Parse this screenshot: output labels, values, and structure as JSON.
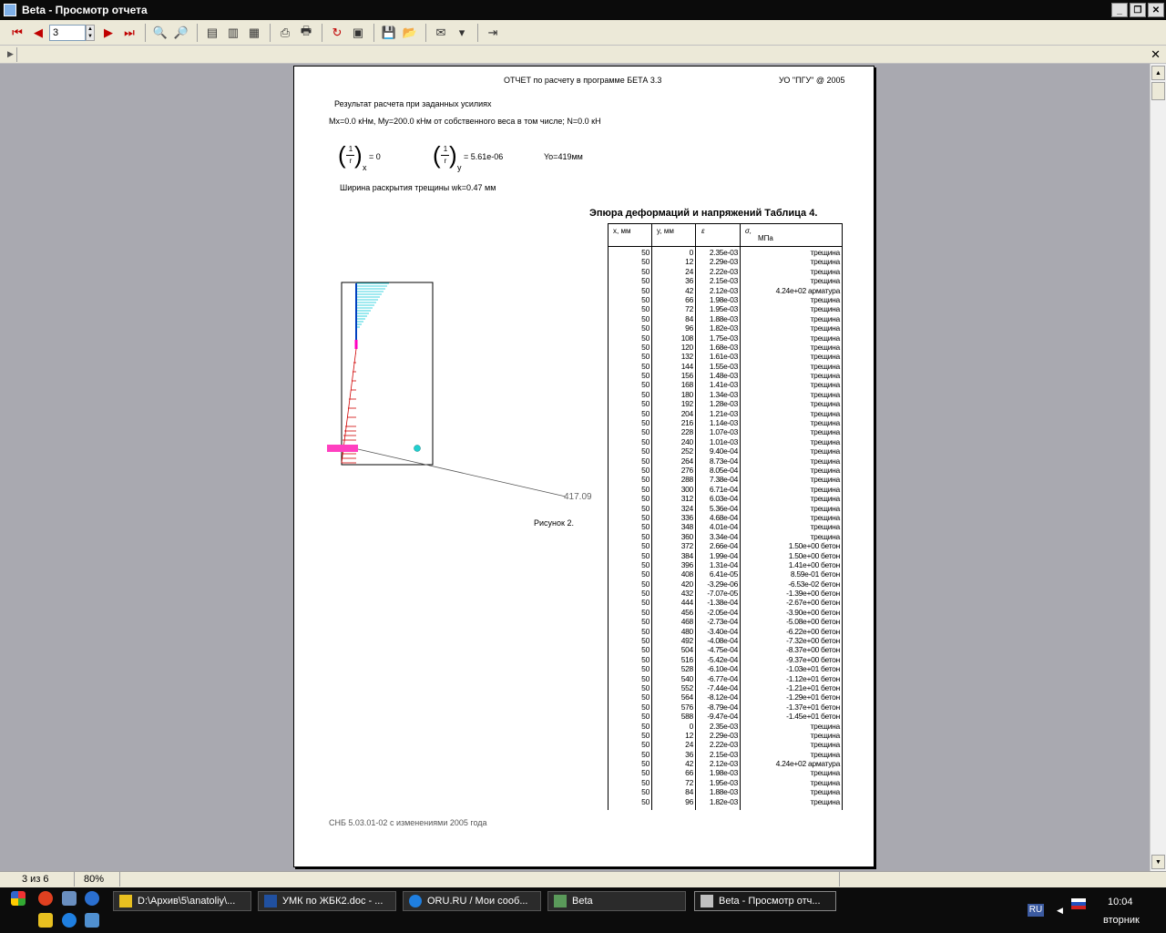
{
  "window": {
    "title": "Beta - Просмотр отчета"
  },
  "toolbar": {
    "page_value": "3"
  },
  "report": {
    "header_center": "ОТЧЕТ по расчету в программе БЕТА 3.3",
    "header_right": "УО \"ПГУ\" @ 2005",
    "result_title": "Результат расчета при заданных усилиях",
    "loads": "Mx=0.0 кНм,  My=200.0 кНм  от собственного веса в том числе;   N=0.0 кН",
    "curv_x_num": "1",
    "curv_x_den": "r",
    "curv_x_sub": "x",
    "curv_x_val": "=  0",
    "curv_y_num": "1",
    "curv_y_den": "r",
    "curv_y_sub": "y",
    "curv_y_val": "=  5.61e-06",
    "yo": "Yo=419мм",
    "crack": "Ширина раскрытия трещины wk=0.47 мм",
    "table_title": "Эпюра деформаций и напряжений    Таблица 4.",
    "figure_label": "Рисунок 2.",
    "dim_label": "417.09",
    "footer": "СНБ 5.03.01-02 с изменениями 2005 года"
  },
  "table": {
    "headers": {
      "x": "x, мм",
      "y": "y, мм",
      "eps": "ε",
      "sigma": "σ,",
      "sigma_unit": "МПа"
    },
    "rows": [
      [
        "50",
        "0",
        "2.35e-03",
        "трещина"
      ],
      [
        "50",
        "12",
        "2.29e-03",
        "трещина"
      ],
      [
        "50",
        "24",
        "2.22e-03",
        "трещина"
      ],
      [
        "50",
        "36",
        "2.15e-03",
        "трещина"
      ],
      [
        "50",
        "42",
        "2.12e-03",
        "4.24e+02 арматура"
      ],
      [
        "50",
        "66",
        "1.98e-03",
        "трещина"
      ],
      [
        "50",
        "72",
        "1.95e-03",
        "трещина"
      ],
      [
        "50",
        "84",
        "1.88e-03",
        "трещина"
      ],
      [
        "50",
        "96",
        "1.82e-03",
        "трещина"
      ],
      [
        "50",
        "108",
        "1.75e-03",
        "трещина"
      ],
      [
        "50",
        "120",
        "1.68e-03",
        "трещина"
      ],
      [
        "50",
        "132",
        "1.61e-03",
        "трещина"
      ],
      [
        "50",
        "144",
        "1.55e-03",
        "трещина"
      ],
      [
        "50",
        "156",
        "1.48e-03",
        "трещина"
      ],
      [
        "50",
        "168",
        "1.41e-03",
        "трещина"
      ],
      [
        "50",
        "180",
        "1.34e-03",
        "трещина"
      ],
      [
        "50",
        "192",
        "1.28e-03",
        "трещина"
      ],
      [
        "50",
        "204",
        "1.21e-03",
        "трещина"
      ],
      [
        "50",
        "216",
        "1.14e-03",
        "трещина"
      ],
      [
        "50",
        "228",
        "1.07e-03",
        "трещина"
      ],
      [
        "50",
        "240",
        "1.01e-03",
        "трещина"
      ],
      [
        "50",
        "252",
        "9.40e-04",
        "трещина"
      ],
      [
        "50",
        "264",
        "8.73e-04",
        "трещина"
      ],
      [
        "50",
        "276",
        "8.05e-04",
        "трещина"
      ],
      [
        "50",
        "288",
        "7.38e-04",
        "трещина"
      ],
      [
        "50",
        "300",
        "6.71e-04",
        "трещина"
      ],
      [
        "50",
        "312",
        "6.03e-04",
        "трещина"
      ],
      [
        "50",
        "324",
        "5.36e-04",
        "трещина"
      ],
      [
        "50",
        "336",
        "4.68e-04",
        "трещина"
      ],
      [
        "50",
        "348",
        "4.01e-04",
        "трещина"
      ],
      [
        "50",
        "360",
        "3.34e-04",
        "трещина"
      ],
      [
        "50",
        "372",
        "2.66e-04",
        "1.50e+00 бетон"
      ],
      [
        "50",
        "384",
        "1.99e-04",
        "1.50e+00 бетон"
      ],
      [
        "50",
        "396",
        "1.31e-04",
        "1.41e+00 бетон"
      ],
      [
        "50",
        "408",
        "6.41e-05",
        "8.59e-01 бетон"
      ],
      [
        "50",
        "420",
        "-3.29e-06",
        "-6.53e-02 бетон"
      ],
      [
        "50",
        "432",
        "-7.07e-05",
        "-1.39e+00 бетон"
      ],
      [
        "50",
        "444",
        "-1.38e-04",
        "-2.67e+00 бетон"
      ],
      [
        "50",
        "456",
        "-2.05e-04",
        "-3.90e+00 бетон"
      ],
      [
        "50",
        "468",
        "-2.73e-04",
        "-5.08e+00 бетон"
      ],
      [
        "50",
        "480",
        "-3.40e-04",
        "-6.22e+00 бетон"
      ],
      [
        "50",
        "492",
        "-4.08e-04",
        "-7.32e+00 бетон"
      ],
      [
        "50",
        "504",
        "-4.75e-04",
        "-8.37e+00 бетон"
      ],
      [
        "50",
        "516",
        "-5.42e-04",
        "-9.37e+00 бетон"
      ],
      [
        "50",
        "528",
        "-6.10e-04",
        "-1.03e+01 бетон"
      ],
      [
        "50",
        "540",
        "-6.77e-04",
        "-1.12e+01 бетон"
      ],
      [
        "50",
        "552",
        "-7.44e-04",
        "-1.21e+01 бетон"
      ],
      [
        "50",
        "564",
        "-8.12e-04",
        "-1.29e+01 бетон"
      ],
      [
        "50",
        "576",
        "-8.79e-04",
        "-1.37e+01 бетон"
      ],
      [
        "50",
        "588",
        "-9.47e-04",
        "-1.45e+01 бетон"
      ],
      [
        "50",
        "0",
        "2.35e-03",
        "трещина"
      ],
      [
        "50",
        "12",
        "2.29e-03",
        "трещина"
      ],
      [
        "50",
        "24",
        "2.22e-03",
        "трещина"
      ],
      [
        "50",
        "36",
        "2.15e-03",
        "трещина"
      ],
      [
        "50",
        "42",
        "2.12e-03",
        "4.24e+02 арматура"
      ],
      [
        "50",
        "66",
        "1.98e-03",
        "трещина"
      ],
      [
        "50",
        "72",
        "1.95e-03",
        "трещина"
      ],
      [
        "50",
        "84",
        "1.88e-03",
        "трещина"
      ],
      [
        "50",
        "96",
        "1.82e-03",
        "трещина"
      ]
    ]
  },
  "statusbar": {
    "pages": "3 из 6",
    "zoom": "80%"
  },
  "taskbar": {
    "tasks": [
      "D:\\Архив\\5\\anatoliy\\...",
      "УМК по ЖБК2.doc - ...",
      "ORU.RU / Мои сооб...",
      "Beta",
      "Beta - Просмотр отч..."
    ],
    "lang": "RU",
    "time": "10:04",
    "day": "вторник"
  }
}
